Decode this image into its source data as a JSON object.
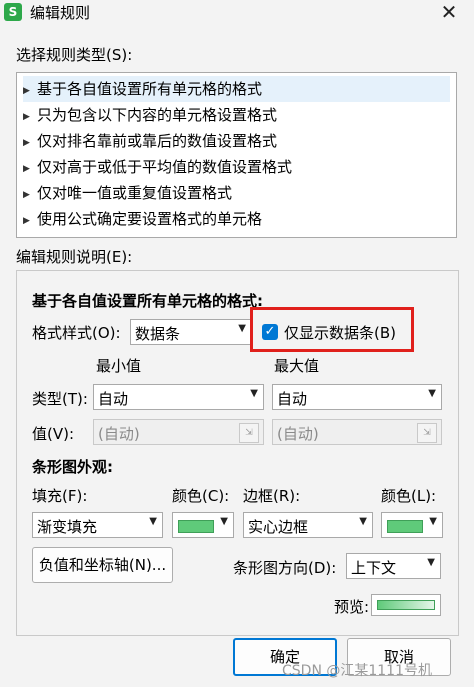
{
  "window": {
    "title": "编辑规则",
    "app_icon_letter": "S"
  },
  "rule_type": {
    "label": "选择规则类型(S):",
    "items": [
      "基于各自值设置所有单元格的格式",
      "只为包含以下内容的单元格设置格式",
      "仅对排名靠前或靠后的数值设置格式",
      "仅对高于或低于平均值的数值设置格式",
      "仅对唯一值或重复值设置格式",
      "使用公式确定要设置格式的单元格"
    ],
    "selected_index": 0
  },
  "description": {
    "label": "编辑规则说明(E):",
    "heading": "基于各自值设置所有单元格的格式:",
    "format_style_label": "格式样式(O):",
    "format_style_value": "数据条",
    "show_bar_only_label": "仅显示数据条(B)",
    "show_bar_only_checked": true,
    "min_header": "最小值",
    "max_header": "最大值",
    "type_label": "类型(T):",
    "min_type": "自动",
    "max_type": "自动",
    "value_label": "值(V):",
    "min_value": "(自动)",
    "max_value": "(自动)"
  },
  "appearance": {
    "heading": "条形图外观:",
    "fill_label": "填充(F):",
    "fill_value": "渐变填充",
    "fill_color_label": "颜色(C):",
    "border_label": "边框(R):",
    "border_value": "实心边框",
    "border_color_label": "颜色(L):",
    "bar_color": "#5fca7a",
    "negative_axis_button": "负值和坐标轴(N)...",
    "bar_direction_label": "条形图方向(D):",
    "bar_direction_value": "上下文",
    "preview_label": "预览:"
  },
  "buttons": {
    "ok": "确定",
    "cancel": "取消"
  },
  "watermark": "CSDN @江某1111号机",
  "colors": {
    "accent": "#0078d4",
    "highlight_box": "#e0201b"
  }
}
